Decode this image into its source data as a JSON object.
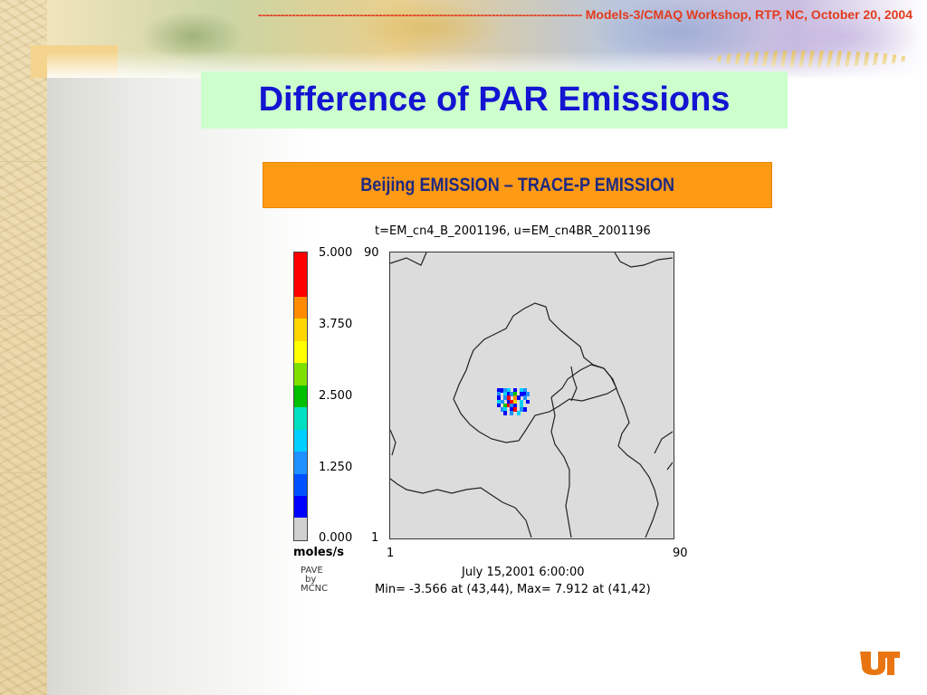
{
  "header": {
    "dashes": "--------------------------------------------------------------------------------------",
    "workshop": "Models-3/CMAQ Workshop, RTP, NC, October 20, 2004"
  },
  "title": "Difference of PAR Emissions",
  "caption": "Beijing EMISSION – TRACE-P EMISSION",
  "plot": {
    "top_label": "t=EM_cn4_B_2001196, u=EM_cn4BR_2001196",
    "colorbar": {
      "ticks": [
        "5.000",
        "3.750",
        "2.500",
        "1.250",
        "0.000"
      ],
      "units": "moles/s",
      "credit": [
        "PAVE",
        "by",
        "MCNC"
      ],
      "colors": [
        "#ff0000",
        "#ff0000",
        "#ff8c00",
        "#ffd700",
        "#ffff00",
        "#7fe000",
        "#00c000",
        "#00e0c0",
        "#00d0ff",
        "#1e90ff",
        "#0050ff",
        "#0000ff",
        "#d0d0d0"
      ]
    },
    "axis": {
      "x_min": "1",
      "x_max": "90",
      "y_min": "1",
      "y_max": "90"
    },
    "date_label": "July 15,2001 6:00:00",
    "minmax_label": "Min=   -3.566 at (43,44),  Max=   7.912 at (41,42)",
    "background_color": "#dcdcdc"
  },
  "logo": {
    "text": "UT",
    "color": "#e87511"
  }
}
